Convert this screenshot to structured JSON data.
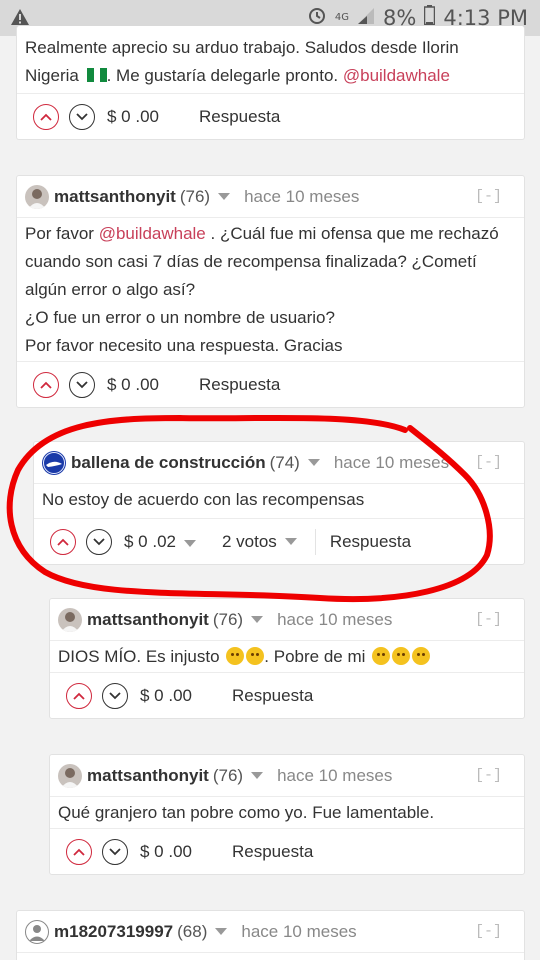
{
  "status_bar": {
    "warning_icon": "warning-triangle-icon",
    "network": "4G",
    "battery": "8%",
    "time": "4:13 PM"
  },
  "colors": {
    "accent": "#c8405a",
    "upvote": "#d0283d",
    "highlight": "#ee0000"
  },
  "comments": [
    {
      "text_lines": [
        "Realmente aprecio su arduo trabajo. Saludos desde Ilorin",
        "Nigeria"
      ],
      "flag_icon": "nigeria-flag-icon",
      "text_tail": ". Me gustaría delegarle pronto.",
      "mention": "@buildawhale",
      "payout": "$ 0 .00",
      "reply": "Respuesta"
    },
    {
      "author": "mattsanthonyit",
      "reputation": "(76)",
      "time": "hace 10 meses",
      "collapse": "[-]",
      "line1_pre": "Por favor",
      "mention": "@buildawhale",
      "line1_post": ". ¿Cuál fue mi ofensa que me rechazó",
      "lines": [
        "cuando son casi 7 días de recompensa finalizada? ¿Cometí",
        "algún error o algo así?",
        "¿O fue un error o un nombre de usuario?",
        "Por favor necesito una respuesta. Gracias"
      ],
      "payout": "$ 0 .00",
      "reply": "Respuesta"
    },
    {
      "author": "ballena de construcción",
      "reputation": "(74)",
      "time": "hace 10 meses",
      "collapse": "[-]",
      "text": "No estoy de acuerdo con las recompensas",
      "payout": "$ 0 .02",
      "votes": "2 votos",
      "reply": "Respuesta"
    },
    {
      "author": "mattsanthonyit",
      "reputation": "(76)",
      "time": "hace 10 meses",
      "collapse": "[-]",
      "text_a": "DIOS MÍO. Es injusto",
      "text_b": ". Pobre de mi",
      "payout": "$ 0 .00",
      "reply": "Respuesta"
    },
    {
      "author": "mattsanthonyit",
      "reputation": "(76)",
      "time": "hace 10 meses",
      "collapse": "[-]",
      "text": "Qué granjero tan pobre como yo. Fue lamentable.",
      "payout": "$ 0 .00",
      "reply": "Respuesta"
    },
    {
      "author": "m18207319997",
      "reputation": "(68)",
      "time": "hace 10 meses",
      "collapse": "[-]"
    }
  ]
}
